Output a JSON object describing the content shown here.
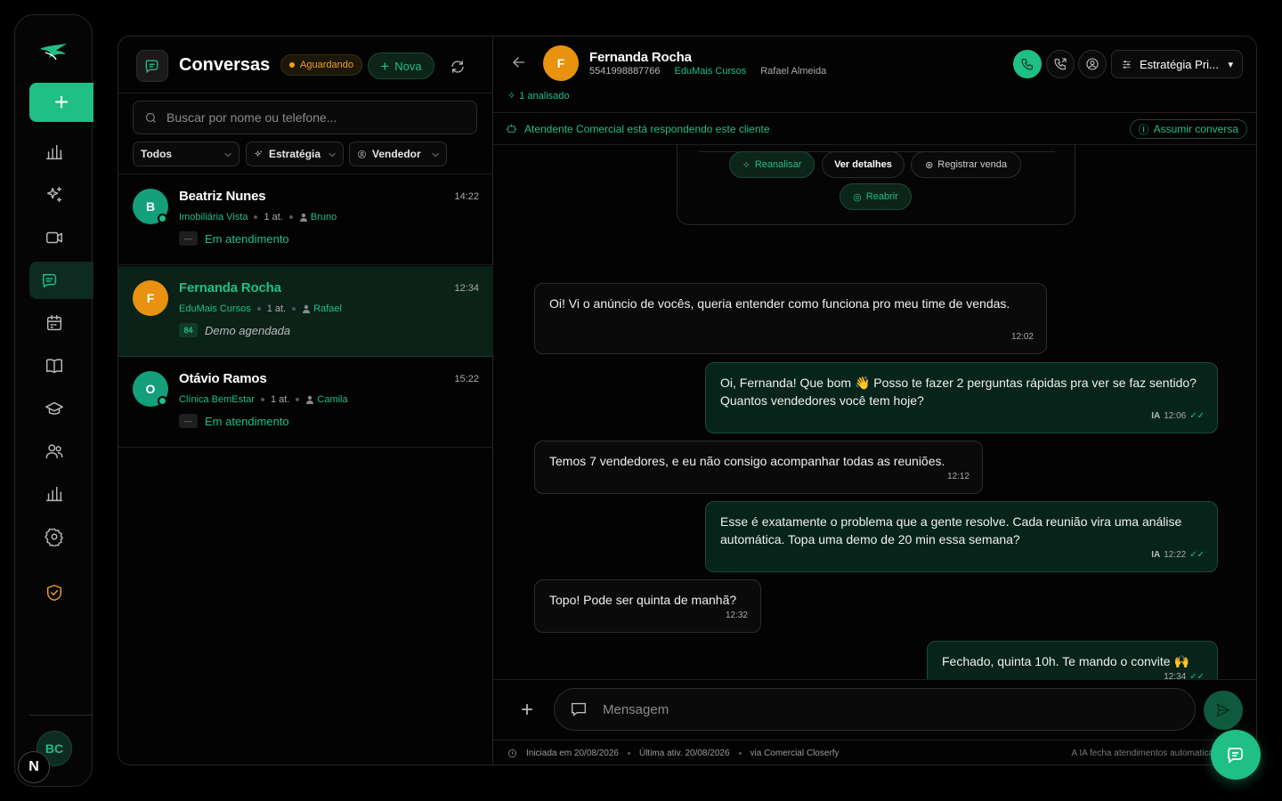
{
  "colors": {
    "accent": "#1fbf86",
    "warning": "#f0a020",
    "avatar_orange": "#e8920f",
    "avatar_teal": "#14a07a"
  },
  "rail": {
    "items": [
      "logo-icon",
      "plus-icon",
      "bar-chart-icon",
      "sparkles-icon",
      "video-icon",
      "chat-icon",
      "calendar-icon",
      "book-icon",
      "graduation-cap-icon",
      "users-icon",
      "bar-chart-icon",
      "gear-icon",
      "shield-check-icon"
    ],
    "user_initials": "BC",
    "badge": "N"
  },
  "list": {
    "title": "Conversas",
    "status_pill": "Aguardando",
    "new_button": "Nova",
    "search_placeholder": "Buscar por nome ou telefone...",
    "filters": {
      "all": "Todos",
      "strategy": "Estratégia",
      "seller": "Vendedor"
    },
    "conversations": [
      {
        "initial": "B",
        "name": "Beatriz Nunes",
        "time": "14:22",
        "company": "Imobiliária Vista",
        "attempts": "1 at.",
        "agent": "Bruno",
        "badge": "—",
        "status": "Em atendimento"
      },
      {
        "initial": "F",
        "name": "Fernanda Rocha",
        "time": "12:34",
        "company": "EduMais Cursos",
        "attempts": "1 at.",
        "agent": "Rafael",
        "badge": "84",
        "status": "Demo agendada"
      },
      {
        "initial": "O",
        "name": "Otávio Ramos",
        "time": "15:22",
        "company": "Clínica BemEstar",
        "attempts": "1 at.",
        "agent": "Camila",
        "badge": "—",
        "status": "Em atendimento"
      }
    ]
  },
  "chat": {
    "contact": {
      "initial": "F",
      "name": "Fernanda Rocha",
      "phone": "5541998887766",
      "company": "EduMais Cursos",
      "agent": "Rafael Almeida",
      "analyzed": "1 analisado"
    },
    "strategy_select": "Estratégia Pri...",
    "banner": "Atendente Comercial está respondendo este cliente",
    "take_over": "Assumir conversa",
    "analysis_actions": {
      "reanalyze": "Reanalisar",
      "details": "Ver detalhes",
      "register_sale": "Registrar venda",
      "reopen": "Reabrir"
    },
    "messages": [
      {
        "dir": "in",
        "text": "Oi! Vi o anúncio de vocês, queria entender como funciona pro meu time de vendas.",
        "time": "12:02"
      },
      {
        "dir": "out",
        "text": "Oi, Fernanda! Que bom 👋 Posso te fazer 2 perguntas rápidas pra ver se faz sentido? Quantos vendedores você tem hoje?",
        "time": "12:06",
        "ia": "IA"
      },
      {
        "dir": "in",
        "text": "Temos 7 vendedores, e eu não consigo acompanhar todas as reuniões.",
        "time": "12:12"
      },
      {
        "dir": "out",
        "text": "Esse é exatamente o problema que a gente resolve. Cada reunião vira uma análise automática. Topa uma demo de 20 min essa semana?",
        "time": "12:22",
        "ia": "IA"
      },
      {
        "dir": "in",
        "text": "Topo! Pode ser quinta de manhã?",
        "time": "12:32"
      },
      {
        "dir": "out",
        "text": "Fechado, quinta 10h. Te mando o convite 🙌",
        "time": "12:34"
      }
    ],
    "composer_placeholder": "Mensagem",
    "footer": {
      "started": "Iniciada em 20/08/2026",
      "last": "Última ativ. 20/08/2026",
      "via": "via Comercial Closerfy",
      "note": "A IA fecha atendimentos automatica"
    }
  }
}
